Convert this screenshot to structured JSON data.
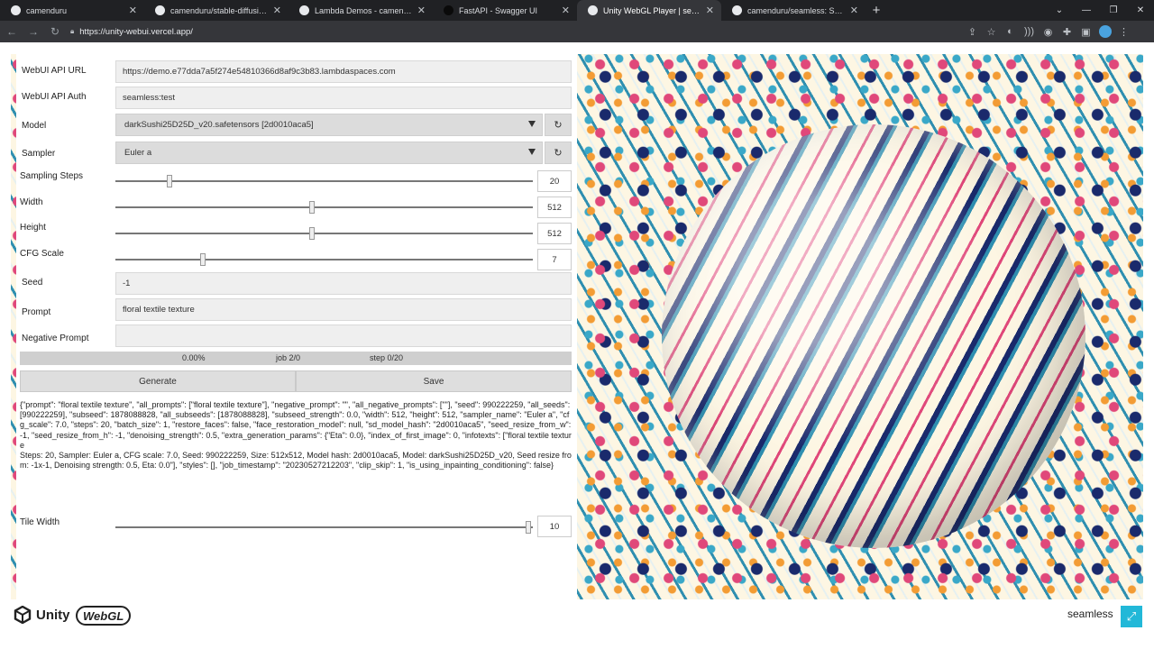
{
  "browser": {
    "tabs": [
      {
        "title": "camenduru",
        "icon": "github-icon"
      },
      {
        "title": "camenduru/stable-diffusion-web...",
        "icon": "github-icon"
      },
      {
        "title": "Lambda Demos - camenduru/sta...",
        "icon": "lambda-icon"
      },
      {
        "title": "FastAPI - Swagger UI",
        "icon": "fastapi-icon"
      },
      {
        "title": "Unity WebGL Player | seamless",
        "icon": "unity-icon"
      },
      {
        "title": "camenduru/seamless: Stable Diff...",
        "icon": "github-icon"
      }
    ],
    "active_tab": 4,
    "url": "https://unity-webui.vercel.app/"
  },
  "form": {
    "api_url_label": "WebUI API URL",
    "api_url_value": "https://demo.e77dda7a5f274e54810366d8af9c3b83.lambdaspaces.com",
    "api_auth_label": "WebUI API Auth",
    "api_auth_value": "seamless:test",
    "model_label": "Model",
    "model_value": "darkSushi25D25D_v20.safetensors [2d0010aca5]",
    "sampler_label": "Sampler",
    "sampler_value": "Euler a",
    "steps_label": "Sampling Steps",
    "steps_value": "20",
    "steps_fraction": 0.13,
    "width_label": "Width",
    "width_value": "512",
    "width_fraction": 0.47,
    "height_label": "Height",
    "height_value": "512",
    "height_fraction": 0.47,
    "cfg_label": "CFG Scale",
    "cfg_value": "7",
    "cfg_fraction": 0.21,
    "seed_label": "Seed",
    "seed_value": "-1",
    "prompt_label": "Prompt",
    "prompt_value": "floral textile texture",
    "negative_label": "Negative Prompt",
    "negative_value": "",
    "progress_percent": "0.00%",
    "progress_job": "job 2/0",
    "progress_step": "step 0/20",
    "generate_label": "Generate",
    "save_label": "Save",
    "response_json": "{\"prompt\": \"floral textile texture\", \"all_prompts\": [\"floral textile texture\"], \"negative_prompt\": \"\", \"all_negative_prompts\": [\"\"], \"seed\": 990222259, \"all_seeds\": [990222259], \"subseed\": 1878088828, \"all_subseeds\": [1878088828], \"subseed_strength\": 0.0, \"width\": 512, \"height\": 512, \"sampler_name\": \"Euler a\", \"cfg_scale\": 7.0, \"steps\": 20, \"batch_size\": 1, \"restore_faces\": false, \"face_restoration_model\": null, \"sd_model_hash\": \"2d0010aca5\", \"seed_resize_from_w\": -1, \"seed_resize_from_h\": -1, \"denoising_strength\": 0.5, \"extra_generation_params\": {\"Eta\": 0.0}, \"index_of_first_image\": 0, \"infotexts\": [\"floral textile texture\nSteps: 20, Sampler: Euler a, CFG scale: 7.0, Seed: 990222259, Size: 512x512, Model hash: 2d0010aca5, Model: darkSushi25D25D_v20, Seed resize from: -1x-1, Denoising strength: 0.5, Eta: 0.0\"], \"styles\": [], \"job_timestamp\": \"20230527212203\", \"clip_skip\": 1, \"is_using_inpainting_conditioning\": false}",
    "tile_width_label": "Tile Width",
    "tile_width_value": "10",
    "tile_width_fraction": 0.99
  },
  "footer": {
    "unity_label": "Unity",
    "webgl_label": "WebGL",
    "project_name": "seamless"
  },
  "colors": {
    "accent": "#22b8d8",
    "chrome_dark": "#202124"
  }
}
